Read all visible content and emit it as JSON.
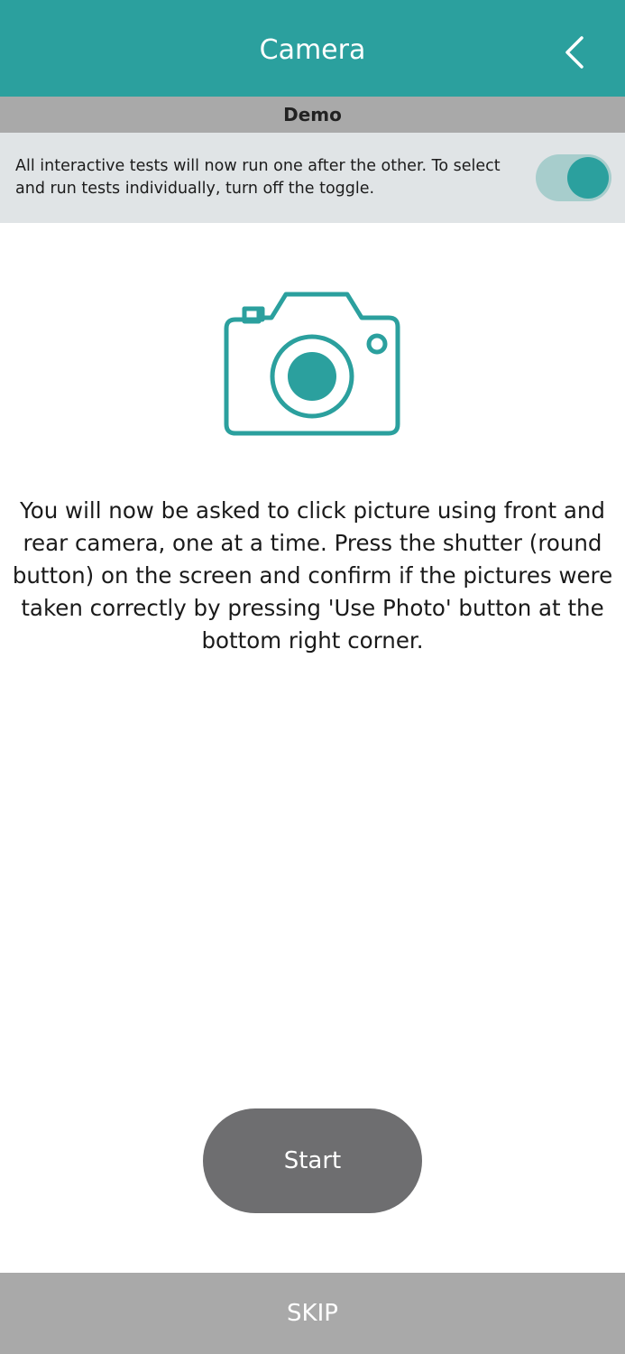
{
  "header": {
    "title": "Camera",
    "back_icon": "chevron-left-icon"
  },
  "demo_bar": {
    "label": "Demo"
  },
  "info_bar": {
    "text": "All interactive tests will now run one after the other. To select and run tests individually, turn off the toggle.",
    "toggle_on": true
  },
  "illustration": {
    "icon": "camera-icon"
  },
  "instructions": "You will now be asked to click picture using front and rear camera, one at a time. Press the shutter (round button) on the screen and confirm if the pictures were taken correctly by pressing 'Use Photo' button at the bottom right corner.",
  "buttons": {
    "start_label": "Start",
    "skip_label": "SKIP"
  },
  "colors": {
    "accent": "#2ba09e",
    "demo_bar": "#a9a9a9",
    "info_bg": "#e0e4e6",
    "start_button": "#6e6e70",
    "skip_bar": "#a9a9a9"
  }
}
